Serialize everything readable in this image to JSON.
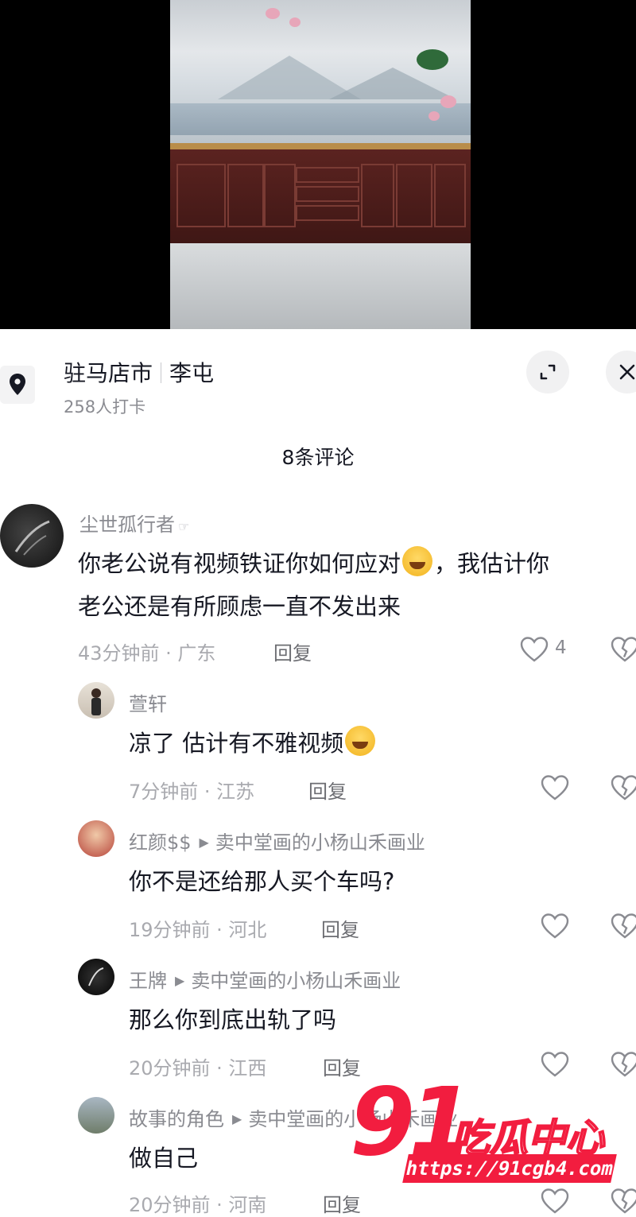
{
  "location": {
    "city": "驻马店市",
    "place": "李屯",
    "checkins": "258人打卡"
  },
  "comment_count": "8条评论",
  "comments": [
    {
      "name": "尘世孤行者",
      "line1": "你老公说有视频铁证你如何应对",
      "line1_after": "，我估计你",
      "line2": "老公还是有所顾虑一直不发出来",
      "meta": "43分钟前 · 广东",
      "reply": "回复",
      "likes": "4"
    },
    {
      "name": "萱轩",
      "text": "凉了 估计有不雅视频",
      "meta": "7分钟前 · 江苏",
      "reply": "回复"
    },
    {
      "name": "红颜$$",
      "reply_to": "卖中堂画的小杨山禾画业",
      "text": "你不是还给那人买个车吗?",
      "meta": "19分钟前 · 河北",
      "reply": "回复"
    },
    {
      "name": "王牌",
      "reply_to": "卖中堂画的小杨山禾画业",
      "text": "那么你到底出轨了吗",
      "meta": "20分钟前 · 江西",
      "reply": "回复"
    },
    {
      "name": "故事的角色",
      "reply_to": "卖中堂画的小杨山禾画业",
      "text": "做自己",
      "meta": "20分钟前 · 河南",
      "reply": "回复"
    }
  ],
  "watermark": {
    "number": "91",
    "name": "吃瓜中心",
    "url": "https://91cgb4.com"
  },
  "colors": {
    "watermark_red": "#f21d3f",
    "muted_text": "#8a8b91"
  }
}
